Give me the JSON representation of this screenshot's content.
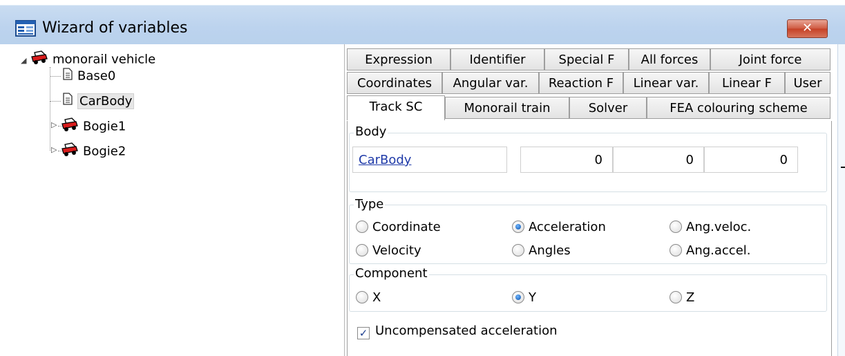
{
  "window": {
    "title": "Wizard of variables",
    "close_glyph": "✕"
  },
  "tree": {
    "root": {
      "label": "monorail vehicle",
      "expander": "◢",
      "icon": "vehicle-icon"
    },
    "children": [
      {
        "label": "Base0",
        "icon": "document-icon"
      },
      {
        "label": "CarBody",
        "icon": "document-icon",
        "selected": true
      },
      {
        "label": "Bogie1",
        "icon": "vehicle-icon",
        "expander": "▷"
      },
      {
        "label": "Bogie2",
        "icon": "vehicle-icon",
        "expander": "▷"
      }
    ]
  },
  "tabs": {
    "row1": [
      "Expression",
      "Identifier",
      "Special F",
      "All forces",
      "Joint force"
    ],
    "row2": [
      "Coordinates",
      "Angular var.",
      "Reaction F",
      "Linear var.",
      "Linear F",
      "User"
    ],
    "row3": [
      "Track SC",
      "Monorail train",
      "Solver",
      "FEA colouring scheme"
    ],
    "active": "Track SC"
  },
  "body_group": {
    "legend": "Body",
    "body_name": "CarBody",
    "values": [
      "0",
      "0",
      "0"
    ]
  },
  "type_group": {
    "legend": "Type",
    "options": [
      "Coordinate",
      "Acceleration",
      "Ang.veloc.",
      "Velocity",
      "Angles",
      "Ang.accel."
    ],
    "selected": "Acceleration"
  },
  "component_group": {
    "legend": "Component",
    "options": [
      "X",
      "Y",
      "Z"
    ],
    "selected": "Y"
  },
  "uncompensated": {
    "label": "Uncompensated acceleration",
    "checked": true,
    "check_glyph": "✓"
  },
  "colors": {
    "accent": "#1f3aa8",
    "close": "#c54126"
  }
}
